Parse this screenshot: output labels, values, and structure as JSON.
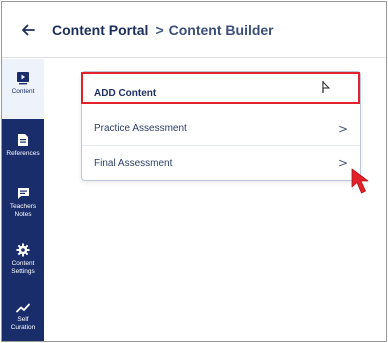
{
  "header": {
    "back_icon": "arrow-left-icon",
    "breadcrumb_root": "Content Portal",
    "breadcrumb_separator": ">",
    "breadcrumb_current": "Content Builder"
  },
  "sidebar": {
    "items": [
      {
        "label": "Content",
        "icon": "content-icon",
        "active": true
      },
      {
        "label": "References",
        "icon": "document-icon",
        "active": false
      },
      {
        "label": "Teachers Notes",
        "icon": "notes-icon",
        "active": false
      },
      {
        "label": "Content Settings",
        "icon": "gear-icon",
        "active": false
      },
      {
        "label": "Self Curation",
        "icon": "trend-icon",
        "active": false
      }
    ]
  },
  "dropdown": {
    "items": [
      {
        "label": "ADD Content"
      },
      {
        "label": "Practice Assessment",
        "chevron": ">"
      },
      {
        "label": "Final Assessment",
        "chevron": ">"
      }
    ]
  },
  "colors": {
    "sidebar_bg": "#1a2d6b",
    "highlight_border": "#e2212a",
    "annotation_arrow": "#e2212a",
    "text_dark": "#1f3263"
  }
}
